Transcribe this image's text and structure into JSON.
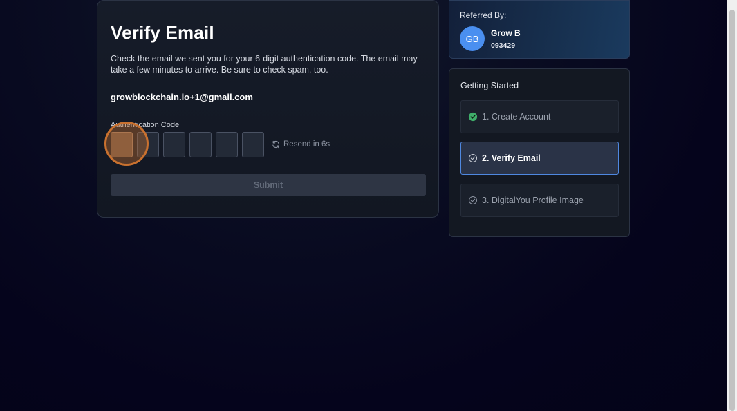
{
  "verify": {
    "title": "Verify Email",
    "description": "Check the email we sent you for your 6-digit authentication code. The email may take a few minutes to arrive. Be sure to check spam, too.",
    "email": "growblockchain.io+1@gmail.com",
    "code_label": "Authentication Code",
    "code_digits": [
      "",
      "",
      "",
      "",
      "",
      ""
    ],
    "resend_label": "Resend in 6s",
    "submit_label": "Submit"
  },
  "referral": {
    "label": "Referred By:",
    "avatar_initials": "GB",
    "name": "Grow B",
    "code": "093429"
  },
  "steps": {
    "title": "Getting Started",
    "items": [
      {
        "label": "1. Create Account",
        "status": "complete"
      },
      {
        "label": "2. Verify Email",
        "status": "current"
      },
      {
        "label": "3. DigitalYou Profile Image",
        "status": "pending"
      }
    ]
  },
  "colors": {
    "complete_check": "#3fae6a",
    "active_border": "#4f88e0",
    "avatar": "#4a8ff0",
    "focus_ring": "#c9712f"
  },
  "icons": {
    "resend": "refresh-icon",
    "step_complete": "check-circle-filled-icon",
    "step_pending": "check-circle-outline-icon"
  }
}
